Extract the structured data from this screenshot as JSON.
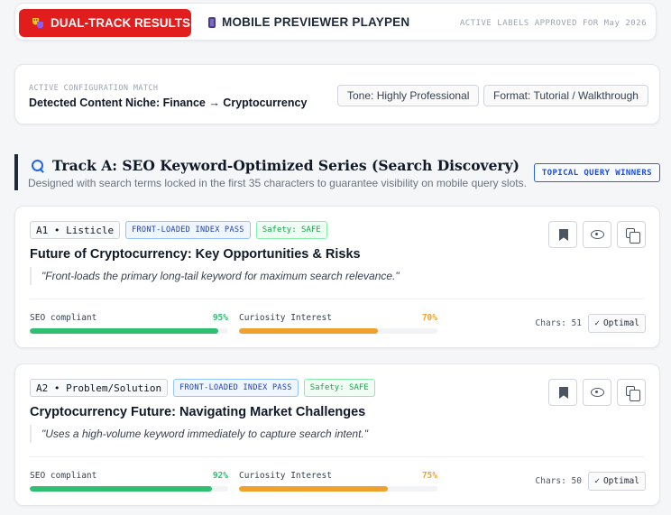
{
  "header": {
    "dual_track_label": "DUAL-TRACK RESULTS",
    "playpen_label": "MOBILE PREVIEWER PLAYPEN",
    "approved_text": "ACTIVE LABELS APPROVED FOR May 2026"
  },
  "config": {
    "label": "ACTIVE CONFIGURATION MATCH",
    "niche": "Detected Content Niche: Finance → Cryptocurrency",
    "tone": "Tone: Highly Professional",
    "format": "Format: Tutorial / Walkthrough"
  },
  "track_a": {
    "title": "Track A: SEO Keyword-Optimized Series (Search Discovery)",
    "subtitle": "Designed with search terms locked in the first 35 characters to guarantee visibility on mobile query slots.",
    "badge": "TOPICAL QUERY WINNERS"
  },
  "cards": [
    {
      "id_tag": "A1 • Listicle",
      "pass_tag": "FRONT-LOADED INDEX PASS",
      "safety_tag": "Safety: SAFE",
      "title": "Future of Cryptocurrency: Key Opportunities & Risks",
      "quote": "\"Front-loads the primary long-tail keyword for maximum search relevance.\"",
      "seo_label": "SEO compliant",
      "seo_pct": "95%",
      "seo_value": 95,
      "curiosity_label": "Curiosity Interest",
      "curiosity_pct": "70%",
      "curiosity_value": 70,
      "chars": "Chars: 51",
      "optimal": "Optimal"
    },
    {
      "id_tag": "A2 • Problem/Solution",
      "pass_tag": "FRONT-LOADED INDEX PASS",
      "safety_tag": "Safety: SAFE",
      "title": "Cryptocurrency Future: Navigating Market Challenges",
      "quote": "\"Uses a high-volume keyword immediately to capture search intent.\"",
      "seo_label": "SEO compliant",
      "seo_pct": "92%",
      "seo_value": 92,
      "curiosity_label": "Curiosity Interest",
      "curiosity_pct": "75%",
      "curiosity_value": 75,
      "chars": "Chars: 50",
      "optimal": "Optimal"
    }
  ],
  "colors": {
    "accent_red": "#e11d1d",
    "seo_green": "#2fbf71",
    "curiosity_orange": "#f0a12b",
    "link_blue": "#2563eb"
  },
  "icons": {
    "dual_track": "theater-masks-icon",
    "playpen": "mobile-phone-icon",
    "track": "search-icon",
    "bookmark": "bookmark-icon",
    "preview": "eye-icon",
    "copy": "copy-icon",
    "check": "check-icon"
  }
}
